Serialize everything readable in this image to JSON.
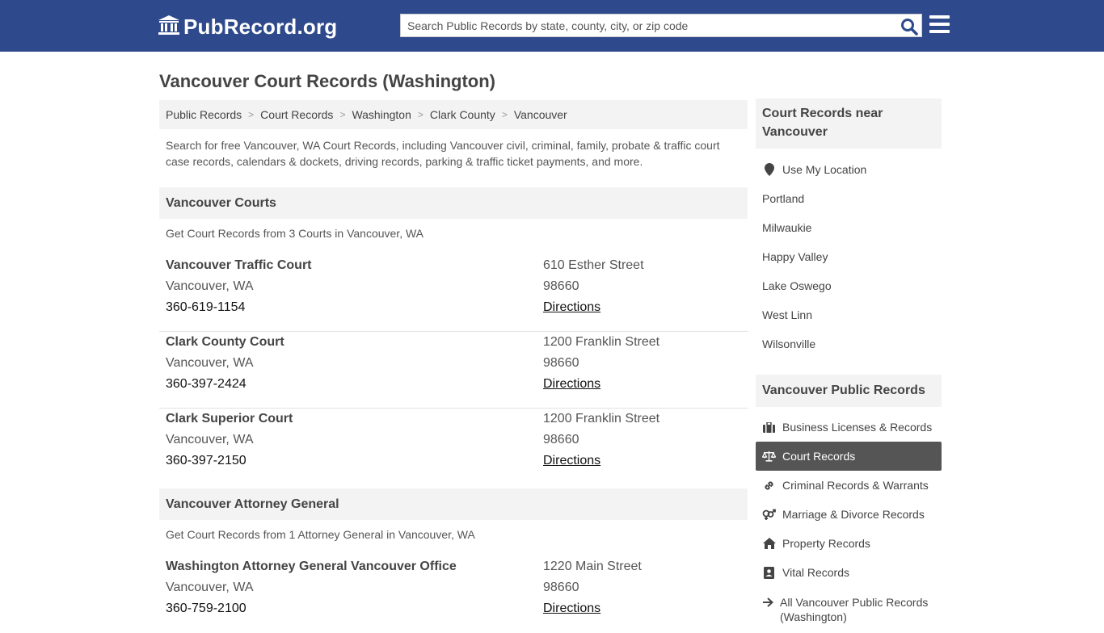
{
  "header": {
    "logo_text": "PubRecord.org",
    "search_placeholder": "Search Public Records by state, county, city, or zip code",
    "brand_color": "#2f4a8c"
  },
  "page_title": "Vancouver Court Records (Washington)",
  "breadcrumb": [
    "Public Records",
    "Court Records",
    "Washington",
    "Clark County",
    "Vancouver"
  ],
  "intro": "Search for free Vancouver, WA Court Records, including Vancouver civil, criminal, family, probate & traffic court case records, calendars & dockets, driving records, parking & traffic ticket payments, and more.",
  "courts_section": {
    "title": "Vancouver Courts",
    "subtitle": "Get Court Records from 3 Courts in Vancouver, WA",
    "items": [
      {
        "name": "Vancouver Traffic Court",
        "city": "Vancouver, WA",
        "phone": "360-619-1154",
        "street": "610 Esther Street",
        "zip": "98660",
        "directions": "Directions"
      },
      {
        "name": "Clark County Court",
        "city": "Vancouver, WA",
        "phone": "360-397-2424",
        "street": "1200 Franklin Street",
        "zip": "98660",
        "directions": "Directions"
      },
      {
        "name": "Clark Superior Court",
        "city": "Vancouver, WA",
        "phone": "360-397-2150",
        "street": "1200 Franklin Street",
        "zip": "98660",
        "directions": "Directions"
      }
    ]
  },
  "ag_section": {
    "title": "Vancouver Attorney General",
    "subtitle": "Get Court Records from 1 Attorney General in Vancouver, WA",
    "items": [
      {
        "name": "Washington Attorney General Vancouver Office",
        "city": "Vancouver, WA",
        "phone": "360-759-2100",
        "street": "1220 Main Street",
        "zip": "98660",
        "directions": "Directions"
      }
    ]
  },
  "sidebar": {
    "nearby_title": "Court Records near Vancouver",
    "use_location": "Use My Location",
    "nearby": [
      "Portland",
      "Milwaukie",
      "Happy Valley",
      "Lake Oswego",
      "West Linn",
      "Wilsonville"
    ],
    "public_title": "Vancouver Public Records",
    "public_items": [
      {
        "label": "Business Licenses & Records",
        "icon": "briefcase-icon"
      },
      {
        "label": "Court Records",
        "icon": "scales-icon",
        "active": true
      },
      {
        "label": "Criminal Records & Warrants",
        "icon": "link-icon"
      },
      {
        "label": "Marriage & Divorce Records",
        "icon": "gender-icon"
      },
      {
        "label": "Property Records",
        "icon": "home-icon"
      },
      {
        "label": "Vital Records",
        "icon": "id-card-icon"
      },
      {
        "label": "All Vancouver Public Records (Washington)",
        "icon": "arrow-right-icon"
      }
    ]
  }
}
